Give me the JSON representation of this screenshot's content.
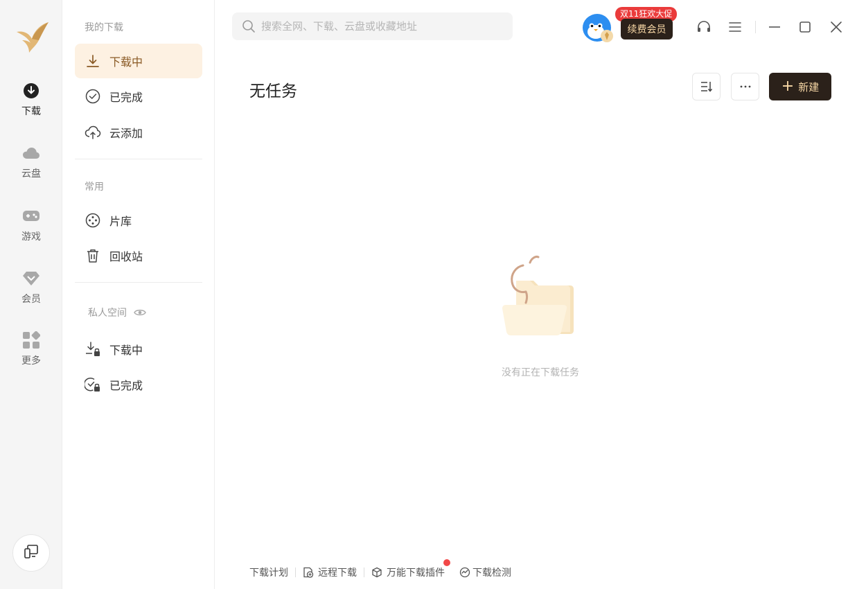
{
  "rail": {
    "items": [
      {
        "label": "下载",
        "icon": "download-circle-icon",
        "active": true
      },
      {
        "label": "云盘",
        "icon": "cloud-icon"
      },
      {
        "label": "游戏",
        "icon": "gamepad-icon"
      },
      {
        "label": "会员",
        "icon": "diamond-icon"
      },
      {
        "label": "更多",
        "icon": "apps-grid-icon"
      }
    ],
    "bottom_icon": "device-switch-icon"
  },
  "subnav": {
    "my_downloads_header": "我的下载",
    "items": [
      {
        "label": "下载中",
        "icon": "download-arrow-icon",
        "active": true
      },
      {
        "label": "已完成",
        "icon": "check-circle-icon"
      },
      {
        "label": "云添加",
        "icon": "cloud-upload-icon"
      }
    ],
    "common_header": "常用",
    "common_items": [
      {
        "label": "片库",
        "icon": "film-reel-icon"
      },
      {
        "label": "回收站",
        "icon": "trash-icon"
      }
    ],
    "private_header": "私人空间",
    "private_items": [
      {
        "label": "下载中",
        "icon": "download-lock-icon"
      },
      {
        "label": "已完成",
        "icon": "check-lock-icon"
      }
    ]
  },
  "search": {
    "placeholder": "搜索全网、下载、云盘或收藏地址"
  },
  "header": {
    "promo_badge": "双11狂欢大促",
    "vip_button": "续费会员"
  },
  "main": {
    "title": "无任务",
    "new_button": "新建",
    "empty_text": "没有正在下载任务"
  },
  "footer": {
    "items": [
      {
        "label": "下载计划"
      },
      {
        "label": "远程下载",
        "icon": "remote-download-icon"
      },
      {
        "label": "万能下载插件",
        "icon": "cube-icon",
        "dot": true
      },
      {
        "label": "下载检测",
        "icon": "detect-icon"
      }
    ]
  },
  "colors": {
    "accent_dark": "#2b211a",
    "accent_gold": "#f8d8a6",
    "active_bg": "#fdf1e2",
    "promo_red": "#ea3b3b"
  }
}
